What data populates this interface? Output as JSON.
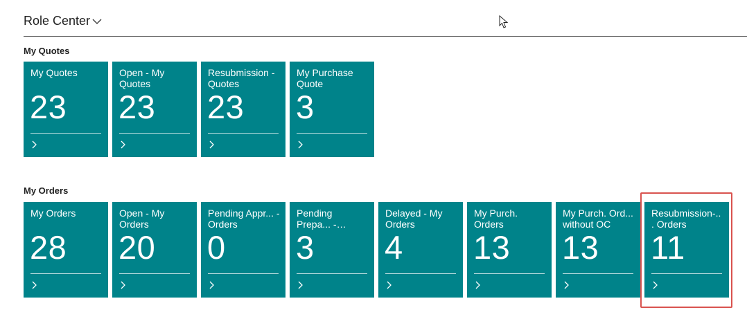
{
  "header": {
    "title": "Role Center",
    "menu_icon": "chevron-down-icon"
  },
  "sections": {
    "quotes": {
      "title": "My Quotes",
      "tiles": [
        {
          "label": "My Quotes",
          "value": "23"
        },
        {
          "label": "Open - My Quotes",
          "value": "23"
        },
        {
          "label": "Resubmission - Quotes",
          "value": "23"
        },
        {
          "label": "My Purchase Quote",
          "value": "3"
        }
      ]
    },
    "orders": {
      "title": "My Orders",
      "tiles": [
        {
          "label": "My Orders",
          "value": "28"
        },
        {
          "label": "Open - My Orders",
          "value": "20"
        },
        {
          "label": "Pending Appr... - Orders",
          "value": "0"
        },
        {
          "label": "Pending Prepa... - Orders",
          "value": "3"
        },
        {
          "label": "Delayed - My Orders",
          "value": "4"
        },
        {
          "label": "My Purch. Orders",
          "value": "13"
        },
        {
          "label": "My Purch. Ord... without OC",
          "value": "13"
        },
        {
          "label": "Resubmission-... Orders",
          "value": "11"
        }
      ]
    }
  },
  "colors": {
    "tile_bg": "#00838a",
    "tile_text": "#ffffff",
    "highlight": "#d9534f"
  },
  "highlighted_tile": "Resubmission-... Orders"
}
